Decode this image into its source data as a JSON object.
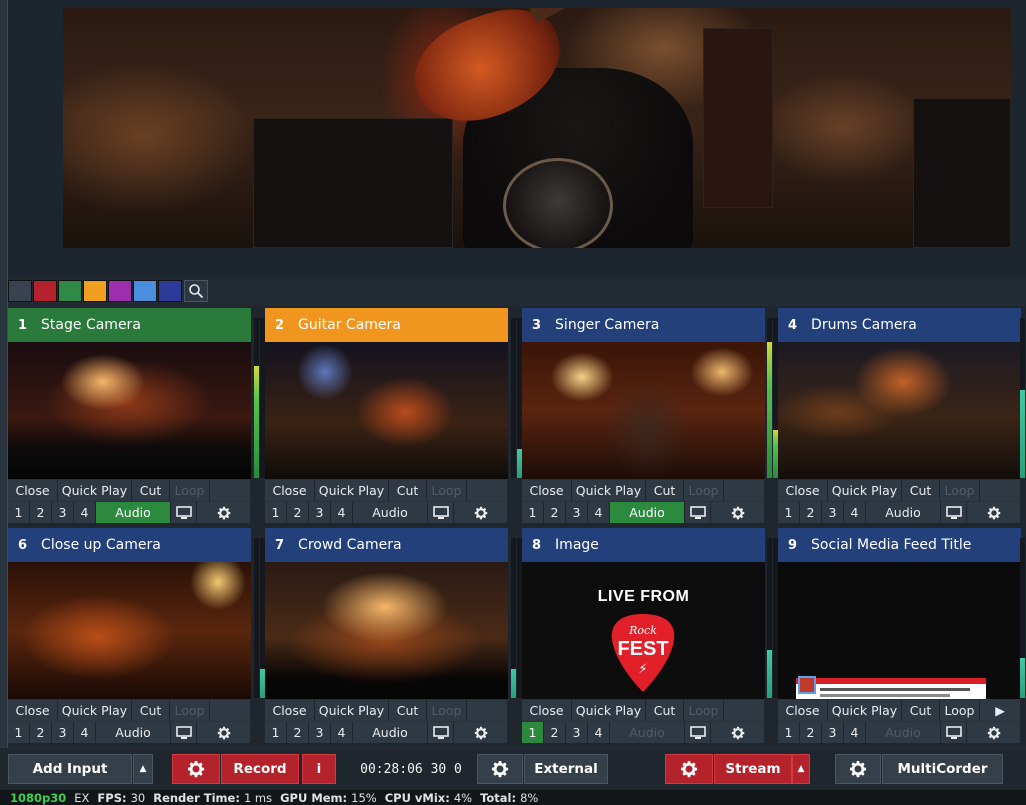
{
  "colors": {
    "swatches": [
      "#3a4250",
      "#b3222d",
      "#2f8a48",
      "#f0a020",
      "#9b2fae",
      "#4a8fde",
      "#2c3a9a"
    ],
    "active": "#2b8a3e",
    "record_red": "#b4232b",
    "status_green": "#3bd14f"
  },
  "filter": {
    "search_icon": "magnifier-icon"
  },
  "inputs": [
    {
      "number": "1",
      "title": "Stage Camera",
      "header_color": "#2a7a3b",
      "row1": {
        "close": "Close",
        "quick_play": "Quick Play",
        "cut": "Cut",
        "loop": "Loop"
      },
      "row2": {
        "n1": "1",
        "n2": "2",
        "n3": "3",
        "n4": "4",
        "audio": "Audio"
      },
      "audio_on": true,
      "loop_dim": true
    },
    {
      "number": "2",
      "title": "Guitar Camera",
      "header_color": "#f0961e",
      "row1": {
        "close": "Close",
        "quick_play": "Quick Play",
        "cut": "Cut",
        "loop": "Loop"
      },
      "row2": {
        "n1": "1",
        "n2": "2",
        "n3": "3",
        "n4": "4",
        "audio": "Audio"
      },
      "audio_on": false,
      "loop_dim": true
    },
    {
      "number": "3",
      "title": "Singer Camera",
      "header_color": "#23407a",
      "row1": {
        "close": "Close",
        "quick_play": "Quick Play",
        "cut": "Cut",
        "loop": "Loop"
      },
      "row2": {
        "n1": "1",
        "n2": "2",
        "n3": "3",
        "n4": "4",
        "audio": "Audio"
      },
      "audio_on": true,
      "loop_dim": true
    },
    {
      "number": "4",
      "title": "Drums Camera",
      "header_color": "#23407a",
      "row1": {
        "close": "Close",
        "quick_play": "Quick Play",
        "cut": "Cut",
        "loop": "Loop"
      },
      "row2": {
        "n1": "1",
        "n2": "2",
        "n3": "3",
        "n4": "4",
        "audio": "Audio"
      },
      "audio_on": false,
      "loop_dim": true
    },
    {
      "number": "6",
      "title": "Close up Camera",
      "header_color": "#23407a",
      "row1": {
        "close": "Close",
        "quick_play": "Quick Play",
        "cut": "Cut",
        "loop": "Loop"
      },
      "row2": {
        "n1": "1",
        "n2": "2",
        "n3": "3",
        "n4": "4",
        "audio": "Audio"
      },
      "audio_on": false,
      "loop_dim": true
    },
    {
      "number": "7",
      "title": "Crowd Camera",
      "header_color": "#23407a",
      "row1": {
        "close": "Close",
        "quick_play": "Quick Play",
        "cut": "Cut",
        "loop": "Loop"
      },
      "row2": {
        "n1": "1",
        "n2": "2",
        "n3": "3",
        "n4": "4",
        "audio": "Audio"
      },
      "audio_on": false,
      "loop_dim": true
    },
    {
      "number": "8",
      "title": "Image",
      "header_color": "#23407a",
      "row1": {
        "close": "Close",
        "quick_play": "Quick Play",
        "cut": "Cut",
        "loop": "Loop"
      },
      "row2": {
        "n1": "1",
        "n2": "2",
        "n3": "3",
        "n4": "4",
        "audio": "Audio"
      },
      "audio_on": false,
      "loop_dim": true,
      "audio_dim": true,
      "n1_on": true,
      "image_text": {
        "line1": "LIVE FROM",
        "pick_top": "Rock",
        "pick_main": "FEST"
      }
    },
    {
      "number": "9",
      "title": "Social Media Feed Title",
      "header_color": "#23407a",
      "row1": {
        "close": "Close",
        "quick_play": "Quick Play",
        "cut": "Cut",
        "loop": "Loop"
      },
      "row2": {
        "n1": "1",
        "n2": "2",
        "n3": "3",
        "n4": "4",
        "audio": "Audio"
      },
      "audio_on": false,
      "loop_dim": false,
      "audio_dim": true,
      "has_play": true
    }
  ],
  "toolbar": {
    "add_input": "Add Input",
    "record": "Record",
    "info": "i",
    "timecode": "00:28:06 30 0",
    "external": "External",
    "stream": "Stream",
    "multicorder": "MultiCorder"
  },
  "status": {
    "resolution": "1080p30",
    "ex": "EX",
    "fps_label": "FPS:",
    "fps": "30",
    "render_label": "Render Time:",
    "render": "1 ms",
    "gpu_label": "GPU Mem:",
    "gpu": "15%",
    "cpu_label": "CPU vMix:",
    "cpu": "4%",
    "total_label": "Total:",
    "total": "8%"
  },
  "meters": [
    0.7,
    0.0,
    0.85,
    0.78,
    0.0,
    0.18,
    0.3,
    0.55,
    0.18,
    0.0,
    0.0,
    0.25
  ]
}
